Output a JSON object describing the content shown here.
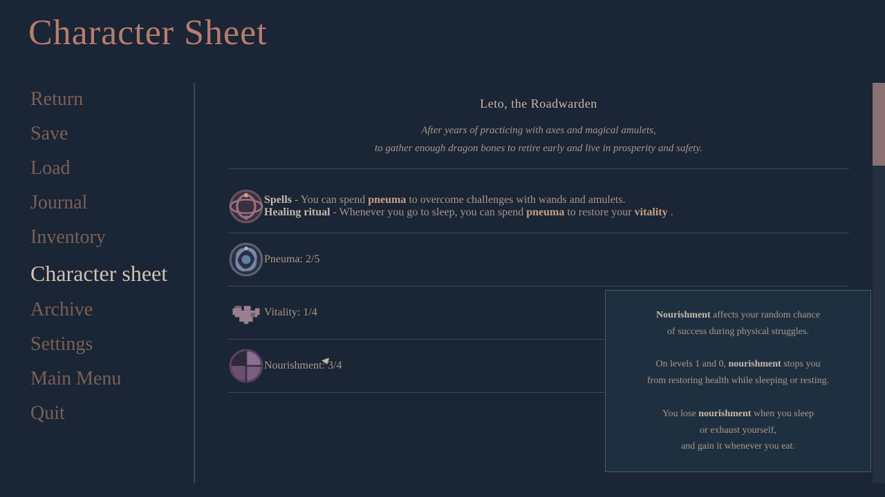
{
  "page": {
    "title": "Character Sheet"
  },
  "sidebar": {
    "items": [
      {
        "id": "return",
        "label": "Return",
        "active": false
      },
      {
        "id": "save",
        "label": "Save",
        "active": false
      },
      {
        "id": "load",
        "label": "Load",
        "active": false
      },
      {
        "id": "journal",
        "label": "Journal",
        "active": false
      },
      {
        "id": "inventory",
        "label": "Inventory",
        "active": false
      },
      {
        "id": "character-sheet",
        "label": "Character sheet",
        "active": true
      },
      {
        "id": "archive",
        "label": "Archive",
        "active": false
      },
      {
        "id": "settings",
        "label": "Settings",
        "active": false
      },
      {
        "id": "main-menu",
        "label": "Main Menu",
        "active": false
      },
      {
        "id": "quit",
        "label": "Quit",
        "active": false
      }
    ]
  },
  "character": {
    "name": "Leto, the Roadwarden",
    "description_line1": "After years of practicing with axes and magical amulets,",
    "description_line2": "to gather enough dragon bones to retire early and live in prosperity and safety.",
    "spells": {
      "line1_prefix": "Spells",
      "line1_connector": " - You can spend ",
      "line1_highlight": "pneuma",
      "line1_suffix": " to overcome challenges with wands and amulets.",
      "line2_prefix": "Healing ritual",
      "line2_connector": " - Whenever you go to sleep, you can spend ",
      "line2_highlight": "pneuma",
      "line2_middle": " to restore your ",
      "line2_highlight2": "vitality",
      "line2_suffix": "."
    },
    "stats": {
      "pneuma_label": "Pneuma: 2/5",
      "vitality_label": "Vitality: 1/4",
      "nourishment_label": "Nourishment: 3/4"
    }
  },
  "tooltip": {
    "line1": "Nourishment",
    "line1_suffix": " affects your random chance",
    "line2": "of success during physical struggles.",
    "line3": "On levels 1 and 0, ",
    "line3_bold": "nourishment",
    "line3_suffix": " stops you",
    "line4": "from restoring health while sleeping or resting.",
    "line5": "You lose ",
    "line5_bold": "nourishment",
    "line5_suffix": " when you sleep",
    "line6": "or exhaust yourself,",
    "line7": "and gain it whenever you eat."
  },
  "colors": {
    "background": "#1a2535",
    "title": "#b87c6e",
    "sidebar_inactive": "#7a6055",
    "sidebar_active": "#d4c0b0",
    "text_muted": "#a89888",
    "text_normal": "#c9b8a8",
    "highlight": "#c9a080",
    "divider": "#3a4a5a",
    "scrollbar": "#8a7070",
    "tooltip_bg": "#1e3040"
  }
}
